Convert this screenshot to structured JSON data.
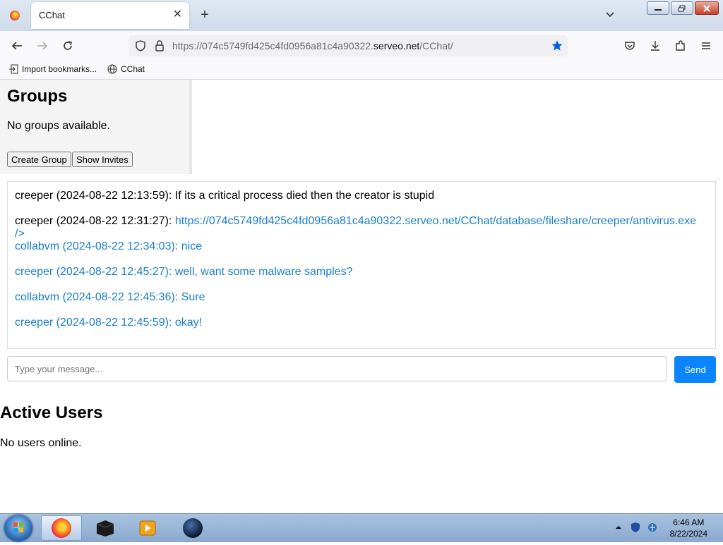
{
  "browser": {
    "tab_title": "CChat",
    "url_prefix": "https://074c5749fd425c4fd0956a81c4a90322.",
    "url_domain": "serveo.net",
    "url_path": "/CChat/",
    "bookmarks": [
      "Import bookmarks...",
      "CChat"
    ]
  },
  "groups": {
    "title": "Groups",
    "empty_text": "No groups available.",
    "create_label": "Create Group",
    "invites_label": "Show Invites"
  },
  "chat": {
    "messages": [
      {
        "text": "creeper (2024-08-22 12:13:59): If its a critical process died then the creator is stupid"
      },
      {
        "prefix": "creeper (2024-08-22 12:31:27): ",
        "link": "https://074c5749fd425c4fd0956a81c4a90322.serveo.net/CChat/database/fileshare/creeper/antivirus.exe",
        "tail": "/>"
      },
      {
        "text": "collabvm (2024-08-22 12:34:03): nice"
      },
      {
        "text": "creeper (2024-08-22 12:45:27): well, want some malware samples?"
      },
      {
        "text": "collabvm (2024-08-22 12:45:36): Sure"
      },
      {
        "text": "creeper (2024-08-22 12:45:59): okay!"
      }
    ],
    "input_placeholder": "Type your message...",
    "send_label": "Send"
  },
  "users": {
    "title": "Active Users",
    "empty_text": "No users online."
  },
  "taskbar": {
    "time": "6:46 AM",
    "date": "8/22/2024"
  },
  "colors": {
    "link": "#1a7fd0",
    "send_button": "#0a84ff",
    "star": "#0060df"
  }
}
